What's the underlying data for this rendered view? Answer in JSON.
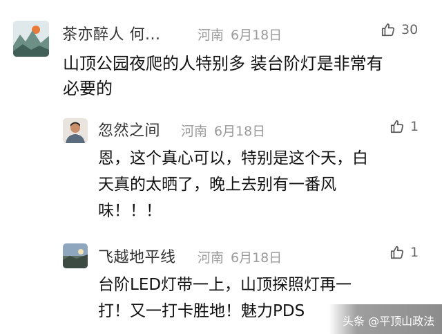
{
  "comments": [
    {
      "author": "茶亦醉人 何...",
      "location": "河南",
      "date": "6月18日",
      "likes": "30",
      "text_lines": [
        "山顶公园夜爬的人特别多  装台阶灯是非常有",
        "必要的"
      ]
    }
  ],
  "replies": [
    {
      "author": "忽然之间",
      "location": "河南",
      "date": "6月18日",
      "likes": "1",
      "text_lines": [
        "恩，这个真心可以，特别是这个天，白",
        "天真的太晒了，晚上去别有一番风",
        "味！！！"
      ]
    },
    {
      "author": "飞越地平线",
      "location": "河南",
      "date": "6月18日",
      "likes": "1",
      "text_lines": [
        "台阶LED灯带一上，山顶探照灯再一",
        "打！又一打卡胜地！魅力PDS"
      ]
    }
  ],
  "icons": {
    "like": "thumbs-up-outline-icon"
  },
  "watermark": {
    "brand": "头条",
    "handle": "@平顶山政法"
  }
}
